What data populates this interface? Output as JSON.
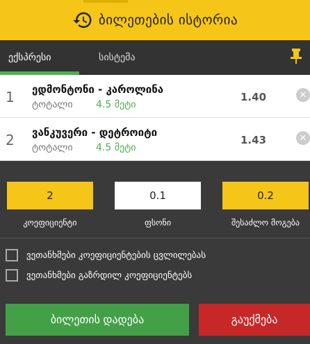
{
  "header": {
    "title": "ბილეთების ისტორია",
    "icon": "history-icon",
    "bg_color": "#f5c518"
  },
  "tabs": [
    {
      "label": "ექსპრესი",
      "active": true
    },
    {
      "label": "სისტემა",
      "active": false
    }
  ],
  "bets": [
    {
      "num": "1",
      "title": "ედმონტონი - კაროლინა",
      "market": "ტოტალი",
      "pick": "4.5 მეტი",
      "odds": "1.40"
    },
    {
      "num": "2",
      "title": "ვანკუვერი - დეტროიტი",
      "market": "ტოტალი",
      "pick": "4.5 მეტი",
      "odds": "1.43"
    }
  ],
  "stake": {
    "coefficient": {
      "value": "2",
      "label": "კოეფიციენტი"
    },
    "fsoni": {
      "value": "0.1",
      "label": "ფსონი"
    },
    "possible_win": {
      "value": "0.2",
      "label": "შესაძლო მოგება"
    }
  },
  "options": [
    {
      "label": "ვეთანხმები კოეფიციენტების ცვლილებას",
      "checked": false
    },
    {
      "label": "ვეთანხმები გაზრდილ კოეფიციენტებს",
      "checked": false
    }
  ],
  "buttons": {
    "place_bet": "ბილეთის დადება",
    "cancel": "გაუქმება"
  },
  "colors": {
    "accent_yellow": "#f5c518",
    "green": "#43a047",
    "red": "#c62828"
  }
}
